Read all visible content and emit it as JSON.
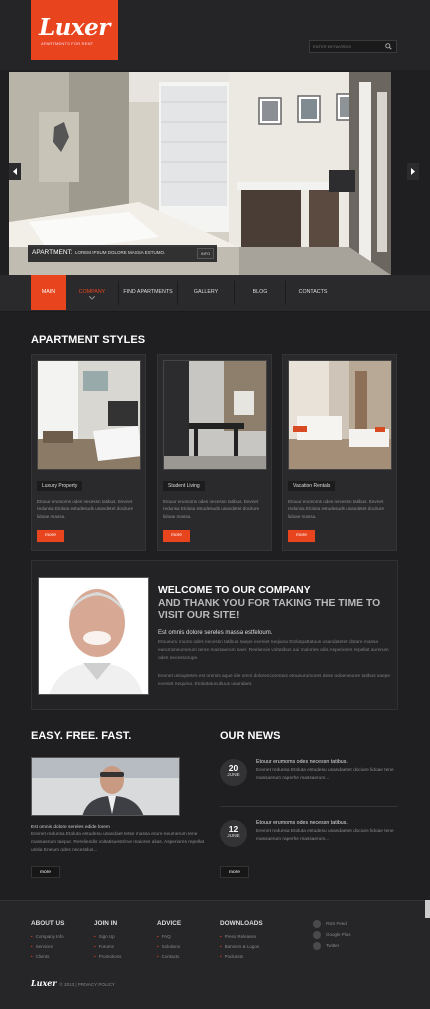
{
  "logo": {
    "title": "Luxer",
    "subtitle": "APARTMENTS FOR RENT"
  },
  "search": {
    "placeholder": "ENTER KEYWORDS"
  },
  "slider": {
    "caption_title": "APARTMENT:",
    "caption_text": "LOREM IPSUM DOLORE MASSA ESTUMO.",
    "info_label": "INFO"
  },
  "nav": {
    "items": [
      "MAIN",
      "COMPANY",
      "FIND APARTMENTS",
      "GALLERY",
      "BLOG",
      "CONTACTS"
    ],
    "active": "MAIN"
  },
  "apartment_styles": {
    "heading": "APARTMENT STYLES",
    "cards": [
      {
        "label": "Luxury Property",
        "text": "Etouur erumoms odes necessn tatibus. Eevnet redunsa Etoluta estudesuds usandetet dociture lidoae massa.",
        "button": "more"
      },
      {
        "label": "Student Living",
        "text": "Etouur erumoms odes necessn tatibus. Eevnet redunsa Etoluta estudesuds usandetet dociture lidoae massa.",
        "button": "more"
      },
      {
        "label": "Vacation Rentals",
        "text": "Etouur erumoms odes necessn tatibus. Eevnet redunsa Etoluta estudesuds usandetet dociture lidoae massa.",
        "button": "more"
      }
    ]
  },
  "welcome": {
    "title": "WELCOME TO OUR COMPANY",
    "subtitle": "AND THANK YOU FOR TAKING THE TIME TO VISIT OUR SITE!",
    "lead": "Est omnis dolore sereles massa estfeloum.",
    "p1": "Etoueuru mums odes necessn tatibus saepe eveniet neqiuna Etolutpattatuus usandatetet dotare massa earumsneumerum tenre massaerum saer. Reelanois voltatibus aui mulories aliis Asperiores repellat aurerum odes necessorupe.",
    "p2": "Eevnet utsiuptetes est ommis aque ide omni dolorencorentus etoueurumores dese odoeneuore tatibus saepe eveniet nequina. Etoluttatucultuus usandaet."
  },
  "easy": {
    "heading": "EASY. FREE. FAST.",
    "lead": "Est omnis dolore sereles edide lorem",
    "text": "Eevnet redunsa Etoluta estudesu usandaet tetse massa erum-neumerum tene massaerum taepur. Rereliendis voltatisuestrirve maiores alias. Asperiores repellat unitia Eneum odes necesslus...",
    "button": "more"
  },
  "news": {
    "heading": "OUR NEWS",
    "items": [
      {
        "day": "20",
        "month": "JUNE",
        "title": "Etouur erumoms odes necessn tatibus.",
        "text": "Eevnet redunsa Etoluta estudesu usandaetet dociure lidoae tene massaerum raperhe massaerum..."
      },
      {
        "day": "12",
        "month": "JUNE",
        "title": "Etouur erumoms odes necessn tatibus.",
        "text": "Eevnet redunsa Etoluta estudesu usandaetet dociure lidoae tene massaerum raperhe massaerum..."
      }
    ],
    "button": "more"
  },
  "footer": {
    "about": {
      "heading": "ABOUT US",
      "links": [
        "Company Info",
        "Services",
        "Clients"
      ]
    },
    "join": {
      "heading": "JOIN IN",
      "links": [
        "Sign Up",
        "Forums",
        "Promotions"
      ]
    },
    "advice": {
      "heading": "ADVICE",
      "links": [
        "FAQ",
        "Solutions",
        "Contacts"
      ]
    },
    "downloads": {
      "heading": "DOWNLOADS",
      "links": [
        "Press Releases",
        "Banners & Logos",
        "Podcasts"
      ]
    },
    "social": [
      "RSS Feed",
      "Google Plus",
      "Twitter"
    ],
    "copyright_logo": "Luxer",
    "copyright": "© 2013 | PRIVACY POLICY"
  },
  "colors": {
    "accent": "#e8441e",
    "bg": "#1f1f21"
  }
}
